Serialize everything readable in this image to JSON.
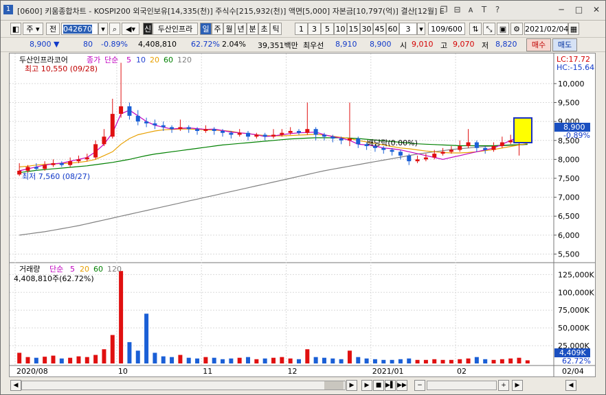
{
  "titlebar": {
    "window_number": "1",
    "title": "[0600] 키움종합차트 - KOSPI200 외국인보유[14,335(천)] 주식수[215,932(천)] 액면[5,000] 자본금[10,797(억)] 결산[12월] E",
    "icons": [
      "restore-icon",
      "pin-icon",
      "font-icon",
      "text-icon",
      "help-icon"
    ],
    "window_buttons": [
      "minimize",
      "maximize",
      "close"
    ]
  },
  "toolbar": {
    "type_label": "주",
    "prev_label": "전",
    "code_value": "042670",
    "stock_name": "두산인프라",
    "period_tabs": [
      "일",
      "주",
      "월",
      "년",
      "분",
      "초",
      "틱"
    ],
    "period_selected": "일",
    "interval_buttons": [
      "1",
      "3",
      "5",
      "10",
      "15",
      "30",
      "45",
      "60"
    ],
    "interval_value": "3",
    "page_count": "109/600",
    "date": "2021/02/04",
    "sin_label": "신"
  },
  "quote": {
    "price": "8,900",
    "change": "80",
    "change_pct": "-0.89%",
    "volume": "4,408,810",
    "vol_ratio": "62.72%",
    "turnover": "2.04%",
    "amount": "39,351백만",
    "ask_label": "최우선",
    "ask": "8,910",
    "bid": "8,900",
    "open_label": "시",
    "open": "9,010",
    "high_label": "고",
    "high": "9,070",
    "low_label": "저",
    "low": "8,820",
    "buy_label": "매수",
    "sell_label": "매도"
  },
  "chart_data": {
    "type": "candlestick",
    "price_panel": {
      "legend": [
        "두산인프라코어",
        "종가",
        "단순",
        "5",
        "10",
        "20",
        "60",
        "120"
      ],
      "max_label": "최고 10,550 (09/28)",
      "min_label": "최저 7,560 (08/27)",
      "annotation": "배당락(0.00%)",
      "lc_label": "LC:17.72",
      "hc_label": "HC:-15.64",
      "current_price_label": "8,900",
      "current_pct_label": "-0.89%",
      "y_ticks": [
        10000,
        9500,
        9000,
        8500,
        8000,
        7500,
        7000,
        6500,
        6000,
        5500
      ],
      "y_tick_labels": [
        "10,000",
        "9,500",
        "9,000",
        "8,500",
        "8,000",
        "7,500",
        "7,000",
        "6,500",
        "6,000",
        "5,500"
      ],
      "ylim": [
        5400,
        10650
      ],
      "ma5": [
        7700,
        7750,
        7800,
        7850,
        7880,
        7900,
        7950,
        8000,
        8050,
        8200,
        8400,
        8700,
        9200,
        9300,
        9150,
        9000,
        8900,
        8850,
        8800,
        8820,
        8830,
        8810,
        8790,
        8800,
        8760,
        8720,
        8700,
        8680,
        8650,
        8600,
        8620,
        8650,
        8680,
        8700,
        8710,
        8720,
        8650,
        8600,
        8560,
        8500,
        8400,
        8380,
        8350,
        8300,
        8280,
        8250,
        8200,
        8150,
        8100,
        8050,
        8000,
        8050,
        8100,
        8150,
        8200,
        8250,
        8300,
        8400,
        8500,
        8600,
        8700
      ],
      "ma20": [
        7800,
        7820,
        7850,
        7870,
        7880,
        7890,
        7900,
        7920,
        7950,
        8000,
        8100,
        8200,
        8400,
        8550,
        8650,
        8700,
        8750,
        8780,
        8790,
        8800,
        8800,
        8790,
        8780,
        8770,
        8760,
        8740,
        8700,
        8680,
        8650,
        8630,
        8620,
        8620,
        8630,
        8640,
        8650,
        8660,
        8640,
        8610,
        8580,
        8550,
        8500,
        8460,
        8420,
        8380,
        8340,
        8300,
        8280,
        8250,
        8220,
        8200,
        8180,
        8170,
        8170,
        8180,
        8200,
        8230,
        8260,
        8300,
        8340,
        8380,
        8420
      ],
      "ma60": [
        7650,
        7680,
        7710,
        7730,
        7750,
        7770,
        7790,
        7810,
        7830,
        7860,
        7890,
        7920,
        7960,
        8000,
        8050,
        8100,
        8140,
        8170,
        8200,
        8230,
        8260,
        8290,
        8320,
        8350,
        8380,
        8400,
        8420,
        8440,
        8460,
        8480,
        8500,
        8520,
        8540,
        8550,
        8560,
        8570,
        8570,
        8570,
        8570,
        8560,
        8550,
        8530,
        8510,
        8490,
        8470,
        8450,
        8430,
        8410,
        8400,
        8390,
        8380,
        8370,
        8360,
        8360,
        8360,
        8360,
        8360,
        8370,
        8380,
        8390,
        8400
      ],
      "ma120": [
        6000,
        6030,
        6060,
        6090,
        6130,
        6170,
        6210,
        6250,
        6300,
        6350,
        6400,
        6450,
        6500,
        6550,
        6600,
        6650,
        6700,
        6750,
        6800,
        6850,
        6900,
        6950,
        7000,
        7050,
        7100,
        7150,
        7200,
        7250,
        7300,
        7350,
        7400,
        7450,
        7500,
        7550,
        7600,
        7650,
        7700,
        7740,
        7780,
        7820,
        7860,
        7900,
        7940,
        7980,
        8020,
        8060,
        8100,
        8140,
        8170,
        8200,
        8230,
        8260,
        8280,
        8300,
        8320,
        8340,
        8350,
        8360,
        8370,
        8380,
        8390
      ],
      "candles": [
        [
          7600,
          7700,
          7900,
          7560
        ],
        [
          7700,
          7800,
          7850,
          7650
        ],
        [
          7800,
          7750,
          7900,
          7700
        ],
        [
          7750,
          7850,
          7950,
          7700
        ],
        [
          7850,
          7900,
          8000,
          7800
        ],
        [
          7900,
          7850,
          7950,
          7800
        ],
        [
          7850,
          7950,
          8050,
          7800
        ],
        [
          7950,
          8000,
          8100,
          7900
        ],
        [
          8000,
          8050,
          8150,
          7950
        ],
        [
          8050,
          8400,
          8500,
          8000
        ],
        [
          8400,
          8600,
          8800,
          8350
        ],
        [
          8600,
          9200,
          9600,
          8550
        ],
        [
          9200,
          9400,
          10550,
          9100
        ],
        [
          9400,
          9150,
          9500,
          9050
        ],
        [
          9150,
          9000,
          9300,
          8900
        ],
        [
          9000,
          8950,
          9100,
          8850
        ],
        [
          8950,
          8900,
          9050,
          8800
        ],
        [
          8900,
          8850,
          9000,
          8750
        ],
        [
          8850,
          8800,
          8900,
          8700
        ],
        [
          8800,
          8850,
          9050,
          8750
        ],
        [
          8850,
          8800,
          8900,
          8700
        ],
        [
          8800,
          8750,
          8850,
          8650
        ],
        [
          8750,
          8800,
          8900,
          8700
        ],
        [
          8800,
          8750,
          8850,
          8650
        ],
        [
          8750,
          8700,
          8800,
          8600
        ],
        [
          8700,
          8650,
          8750,
          8550
        ],
        [
          8650,
          8700,
          8800,
          8600
        ],
        [
          8700,
          8600,
          8750,
          8500
        ],
        [
          8600,
          8650,
          8700,
          8550
        ],
        [
          8650,
          8600,
          8700,
          8500
        ],
        [
          8600,
          8650,
          8800,
          8550
        ],
        [
          8650,
          8700,
          8800,
          8600
        ],
        [
          8700,
          8750,
          8850,
          8650
        ],
        [
          8750,
          8700,
          8800,
          8650
        ],
        [
          8700,
          8800,
          9500,
          8650
        ],
        [
          8800,
          8650,
          8850,
          8500
        ],
        [
          8650,
          8600,
          8700,
          8500
        ],
        [
          8600,
          8550,
          8650,
          8450
        ],
        [
          8550,
          8500,
          8600,
          8400
        ],
        [
          8500,
          8550,
          9500,
          8350
        ],
        [
          8550,
          8400,
          8600,
          8300
        ],
        [
          8400,
          8350,
          8450,
          8250
        ],
        [
          8350,
          8300,
          8400,
          8200
        ],
        [
          8300,
          8250,
          8350,
          8150
        ],
        [
          8250,
          8200,
          8300,
          8100
        ],
        [
          8200,
          8100,
          8250,
          8000
        ],
        [
          8100,
          7950,
          8150,
          7850
        ],
        [
          7950,
          8000,
          8100,
          7900
        ],
        [
          8000,
          8050,
          8150,
          7950
        ],
        [
          8050,
          8150,
          8250,
          8000
        ],
        [
          8150,
          8200,
          8300,
          8100
        ],
        [
          8200,
          8250,
          8350,
          8150
        ],
        [
          8250,
          8350,
          8500,
          8200
        ],
        [
          8350,
          8450,
          8800,
          8300
        ],
        [
          8450,
          8300,
          8500,
          8200
        ],
        [
          8300,
          8250,
          8350,
          8150
        ],
        [
          8250,
          8350,
          8450,
          8200
        ],
        [
          8350,
          8450,
          8600,
          8300
        ],
        [
          8450,
          8500,
          8650,
          8400
        ],
        [
          8500,
          8700,
          8800,
          8100
        ],
        [
          8700,
          8900,
          9070,
          8820
        ]
      ]
    },
    "volume_panel": {
      "legend": [
        "거래량",
        "단순",
        "5",
        "20",
        "60",
        "120"
      ],
      "current_label": "4,408,810주(62.72%)",
      "y_ticks": [
        125000,
        100000,
        75000,
        50000,
        25000
      ],
      "y_tick_labels": [
        "125,000K",
        "100,000K",
        "75,000K",
        "50,000K",
        "25,000K"
      ],
      "ylim": [
        0,
        135000
      ],
      "current_value_label": "4,409K",
      "current_pct_label": "62.72%",
      "volumes": [
        15000,
        9000,
        8000,
        9500,
        11000,
        7000,
        8000,
        10000,
        9000,
        12000,
        20000,
        40000,
        130000,
        30000,
        18000,
        70000,
        15000,
        10000,
        9000,
        12000,
        8000,
        7000,
        9000,
        8000,
        6000,
        7000,
        8000,
        9000,
        6000,
        7000,
        8000,
        9000,
        7000,
        6000,
        20000,
        9000,
        8000,
        7000,
        6000,
        18000,
        9000,
        7000,
        6000,
        5000,
        5000,
        6000,
        7000,
        5000,
        5000,
        6000,
        5000,
        5000,
        6000,
        7000,
        9000,
        6000,
        5000,
        6000,
        7000,
        8000,
        4409
      ]
    },
    "x_tick_labels": [
      "2020/08",
      "10",
      "11",
      "12",
      "2021/01",
      "02"
    ],
    "x_tick_index": [
      0,
      12,
      22,
      32,
      42,
      52
    ],
    "x_end_label": "02/04"
  },
  "colors": {
    "up": "#e01010",
    "down": "#1a5fd6",
    "ma5": "#c000c0",
    "ma10": "#1f3fd0",
    "ma20": "#e8a000",
    "ma60": "#008000",
    "ma120": "#808080",
    "highlight_box": "#ffff00"
  }
}
